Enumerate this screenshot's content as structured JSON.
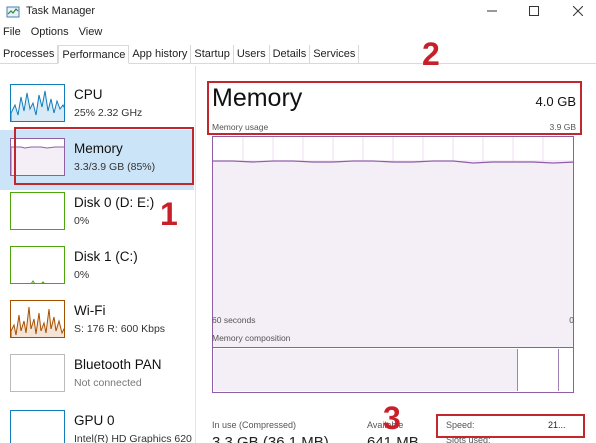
{
  "window": {
    "title": "Task Manager",
    "controls": [
      "minimize-icon",
      "maximize-icon",
      "close-icon"
    ]
  },
  "menu": [
    "File",
    "Options",
    "View"
  ],
  "tabs": [
    {
      "label": "Processes",
      "active": false
    },
    {
      "label": "Performance",
      "active": true
    },
    {
      "label": "App history",
      "active": false
    },
    {
      "label": "Startup",
      "active": false
    },
    {
      "label": "Users",
      "active": false
    },
    {
      "label": "Details",
      "active": false
    },
    {
      "label": "Services",
      "active": false
    }
  ],
  "sidebar": {
    "items": [
      {
        "name": "CPU",
        "sub": "25%  2.32 GHz",
        "selected": false
      },
      {
        "name": "Memory",
        "sub": "3.3/3.9 GB (85%)",
        "selected": true
      },
      {
        "name": "Disk 0 (D: E:)",
        "sub": "0%",
        "selected": false
      },
      {
        "name": "Disk 1 (C:)",
        "sub": "0%",
        "selected": false
      },
      {
        "name": "Wi-Fi",
        "sub": "S: 176  R: 600 Kbps",
        "selected": false
      },
      {
        "name": "Bluetooth PAN",
        "sub": "Not connected",
        "selected": false
      },
      {
        "name": "GPU 0",
        "sub": "Intel(R) HD Graphics 620",
        "selected": false
      }
    ]
  },
  "main": {
    "title": "Memory",
    "total": "4.0 GB",
    "usage_label": "Memory usage",
    "usage_max": "3.9 GB",
    "axis_left": "60 seconds",
    "axis_right": "0",
    "composition_label": "Memory composition",
    "in_use_label": "In use (Compressed)",
    "in_use_value": "3.3 GB (36.1 MB)",
    "available_label": "Available",
    "available_value": "641 MB",
    "speed_label": "Speed:",
    "speed_value": "21...",
    "slots_label": "Slots used:"
  },
  "annotations": [
    "1",
    "2",
    "3"
  ],
  "colors": {
    "memory_accent": "#8e5fa6",
    "annotation": "#c0282d",
    "selection": "#cce4f7",
    "cpu_accent": "#117dbb",
    "disk_accent": "#4da60c",
    "wifi_accent": "#a74f01"
  }
}
